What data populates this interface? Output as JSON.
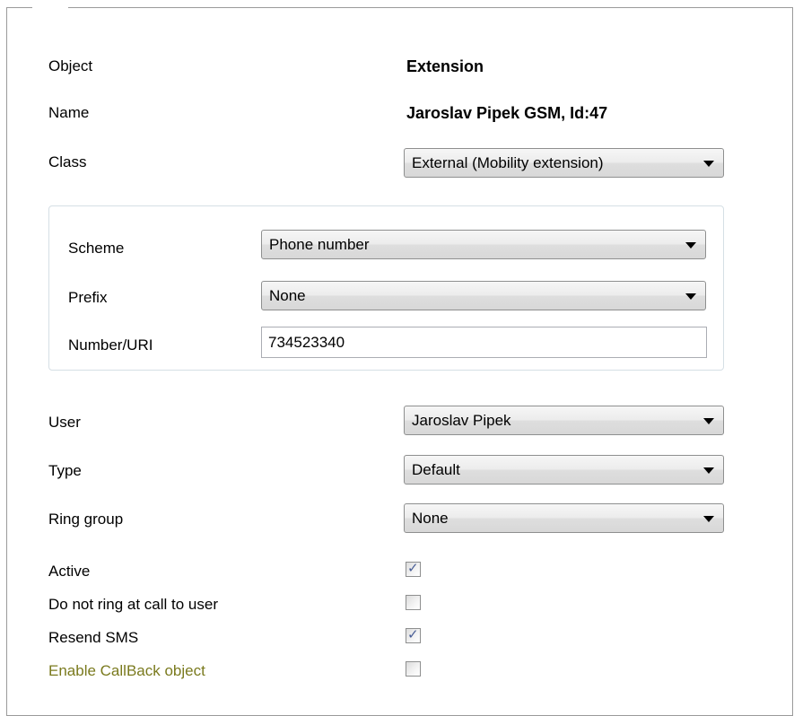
{
  "fields": {
    "object": {
      "label": "Object",
      "value": "Extension"
    },
    "name": {
      "label": "Name",
      "value": "Jaroslav Pipek GSM, Id:47"
    },
    "class": {
      "label": "Class",
      "value": "External (Mobility extension)"
    }
  },
  "scheme_group": {
    "scheme": {
      "label": "Scheme",
      "value": "Phone number"
    },
    "prefix": {
      "label": "Prefix",
      "value": "None"
    },
    "number": {
      "label": "Number/URI",
      "value": "734523340"
    }
  },
  "selects": {
    "user": {
      "label": "User",
      "value": "Jaroslav Pipek"
    },
    "type": {
      "label": "Type",
      "value": "Default"
    },
    "ring_group": {
      "label": "Ring group",
      "value": "None"
    }
  },
  "checkboxes": [
    {
      "label": "Active",
      "checked": true,
      "label_color": "#000000"
    },
    {
      "label": "Do not ring at call to user",
      "checked": false,
      "label_color": "#000000"
    },
    {
      "label": "Resend SMS",
      "checked": true,
      "label_color": "#000000"
    },
    {
      "label": "Enable CallBack object",
      "checked": false,
      "label_color": "#7a7a1e"
    }
  ],
  "glyphs": {
    "check": "✓"
  }
}
